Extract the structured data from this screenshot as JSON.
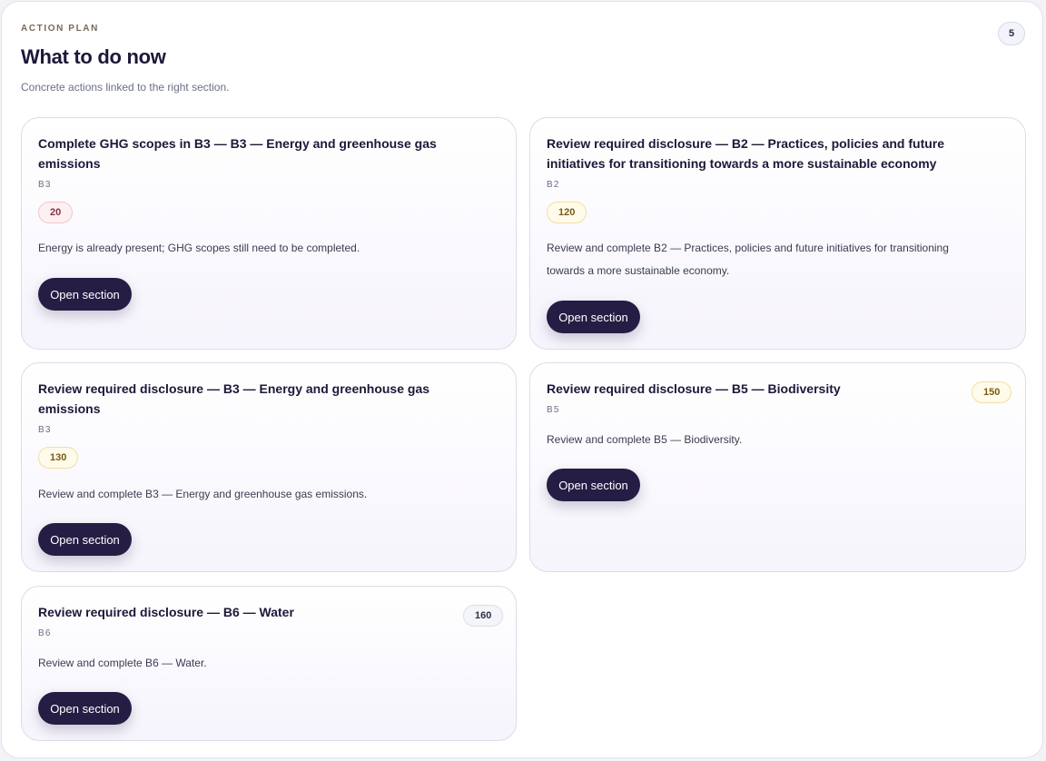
{
  "header": {
    "eyebrow": "ACTION PLAN",
    "title": "What to do now",
    "subtitle": "Concrete actions linked to the right section.",
    "count": "5"
  },
  "colors": {
    "button_bg": "#261d45",
    "badge_red": "#fdf0f1",
    "badge_amber": "#fffbea",
    "badge_gray": "#f4f5f8"
  },
  "cards": [
    {
      "title": "Complete GHG scopes in B3 — B3 — Energy and greenhouse gas emissions",
      "code": "B3",
      "badge": "20",
      "badge_tone": "red",
      "description": "Energy is already present; GHG scopes still need to be completed.",
      "button": "Open section"
    },
    {
      "title": "Review required disclosure — B2 — Practices, policies and future initiatives for transitioning towards a more sustainable economy",
      "code": "B2",
      "badge": "120",
      "badge_tone": "amber",
      "description": "Review and complete B2 — Practices, policies and future initiatives for transitioning towards a more sustainable economy.",
      "button": "Open section"
    },
    {
      "title": "Review required disclosure — B3 — Energy and greenhouse gas emissions",
      "code": "B3",
      "badge": "130",
      "badge_tone": "amber",
      "description": "Review and complete B3 — Energy and greenhouse gas emissions.",
      "button": "Open section"
    },
    {
      "title": "Review required disclosure — B5 — Biodiversity",
      "code": "B5",
      "badge": "150",
      "badge_tone": "amber",
      "description": "Review and complete B5 — Biodiversity.",
      "button": "Open section"
    },
    {
      "title": "Review required disclosure — B6 — Water",
      "code": "B6",
      "badge": "160",
      "badge_tone": "gray",
      "description": "Review and complete B6 — Water.",
      "button": "Open section"
    }
  ]
}
